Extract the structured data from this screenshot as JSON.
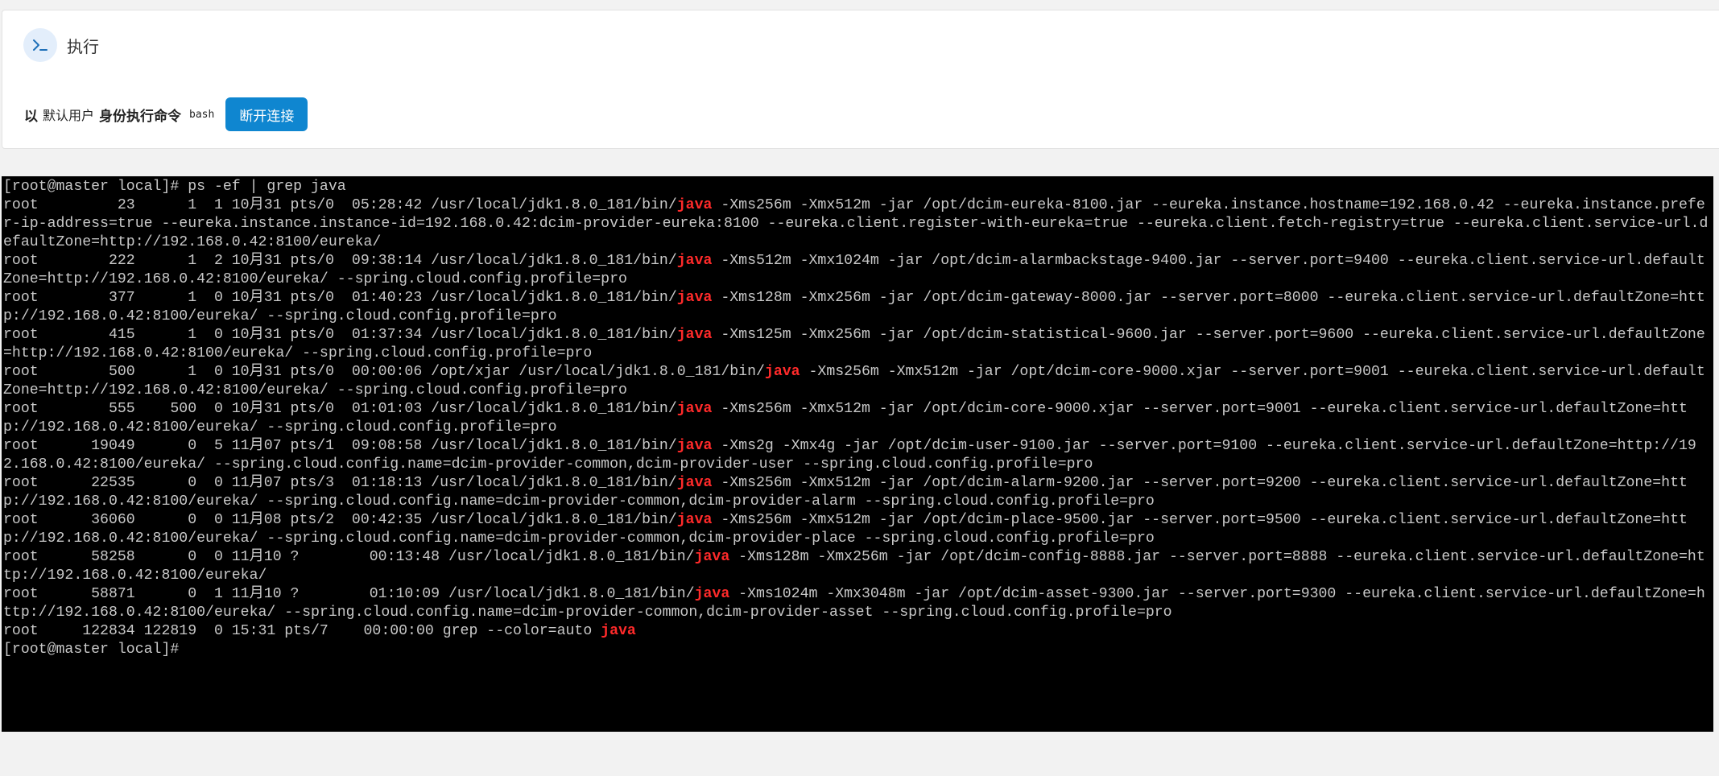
{
  "header": {
    "icon": "terminal-prompt-icon",
    "title": "执行"
  },
  "exec": {
    "prefix": "以",
    "user": "默认用户",
    "middle": "身份执行命令",
    "shell": "bash",
    "disconnect_label": "断开连接"
  },
  "colors": {
    "accent": "#0f86d0",
    "highlight": "#ff2a2a",
    "terminal_bg": "#000000",
    "terminal_fg": "#c8c8c8"
  },
  "terminal": {
    "highlight_word": "java",
    "lines": [
      "[root@master local]# ps -ef | grep java",
      "root         23      1  1 10月31 pts/0  05:28:42 /usr/local/jdk1.8.0_181/bin/java -Xms256m -Xmx512m -jar /opt/dcim-eureka-8100.jar --eureka.instance.hostname=192.168.0.42 --eureka.instance.prefer-ip-address=true --eureka.instance.instance-id=192.168.0.42:dcim-provider-eureka:8100 --eureka.client.register-with-eureka=true --eureka.client.fetch-registry=true --eureka.client.service-url.defaultZone=http://192.168.0.42:8100/eureka/",
      "root        222      1  2 10月31 pts/0  09:38:14 /usr/local/jdk1.8.0_181/bin/java -Xms512m -Xmx1024m -jar /opt/dcim-alarmbackstage-9400.jar --server.port=9400 --eureka.client.service-url.defaultZone=http://192.168.0.42:8100/eureka/ --spring.cloud.config.profile=pro",
      "root        377      1  0 10月31 pts/0  01:40:23 /usr/local/jdk1.8.0_181/bin/java -Xms128m -Xmx256m -jar /opt/dcim-gateway-8000.jar --server.port=8000 --eureka.client.service-url.defaultZone=http://192.168.0.42:8100/eureka/ --spring.cloud.config.profile=pro",
      "root        415      1  0 10月31 pts/0  01:37:34 /usr/local/jdk1.8.0_181/bin/java -Xms125m -Xmx256m -jar /opt/dcim-statistical-9600.jar --server.port=9600 --eureka.client.service-url.defaultZone=http://192.168.0.42:8100/eureka/ --spring.cloud.config.profile=pro",
      "root        500      1  0 10月31 pts/0  00:00:06 /opt/xjar /usr/local/jdk1.8.0_181/bin/java -Xms256m -Xmx512m -jar /opt/dcim-core-9000.xjar --server.port=9001 --eureka.client.service-url.defaultZone=http://192.168.0.42:8100/eureka/ --spring.cloud.config.profile=pro",
      "root        555    500  0 10月31 pts/0  01:01:03 /usr/local/jdk1.8.0_181/bin/java -Xms256m -Xmx512m -jar /opt/dcim-core-9000.xjar --server.port=9001 --eureka.client.service-url.defaultZone=http://192.168.0.42:8100/eureka/ --spring.cloud.config.profile=pro",
      "root      19049      0  5 11月07 pts/1  09:08:58 /usr/local/jdk1.8.0_181/bin/java -Xms2g -Xmx4g -jar /opt/dcim-user-9100.jar --server.port=9100 --eureka.client.service-url.defaultZone=http://192.168.0.42:8100/eureka/ --spring.cloud.config.name=dcim-provider-common,dcim-provider-user --spring.cloud.config.profile=pro",
      "root      22535      0  0 11月07 pts/3  01:18:13 /usr/local/jdk1.8.0_181/bin/java -Xms256m -Xmx512m -jar /opt/dcim-alarm-9200.jar --server.port=9200 --eureka.client.service-url.defaultZone=http://192.168.0.42:8100/eureka/ --spring.cloud.config.name=dcim-provider-common,dcim-provider-alarm --spring.cloud.config.profile=pro",
      "root      36060      0  0 11月08 pts/2  00:42:35 /usr/local/jdk1.8.0_181/bin/java -Xms256m -Xmx512m -jar /opt/dcim-place-9500.jar --server.port=9500 --eureka.client.service-url.defaultZone=http://192.168.0.42:8100/eureka/ --spring.cloud.config.name=dcim-provider-common,dcim-provider-place --spring.cloud.config.profile=pro",
      "root      58258      0  0 11月10 ?        00:13:48 /usr/local/jdk1.8.0_181/bin/java -Xms128m -Xmx256m -jar /opt/dcim-config-8888.jar --server.port=8888 --eureka.client.service-url.defaultZone=http://192.168.0.42:8100/eureka/",
      "root      58871      0  1 11月10 ?        01:10:09 /usr/local/jdk1.8.0_181/bin/java -Xms1024m -Xmx3048m -jar /opt/dcim-asset-9300.jar --server.port=9300 --eureka.client.service-url.defaultZone=http://192.168.0.42:8100/eureka/ --spring.cloud.config.name=dcim-provider-common,dcim-provider-asset --spring.cloud.config.profile=pro",
      "root     122834 122819  0 15:31 pts/7    00:00:00 grep --color=auto java",
      "[root@master local]# "
    ]
  }
}
